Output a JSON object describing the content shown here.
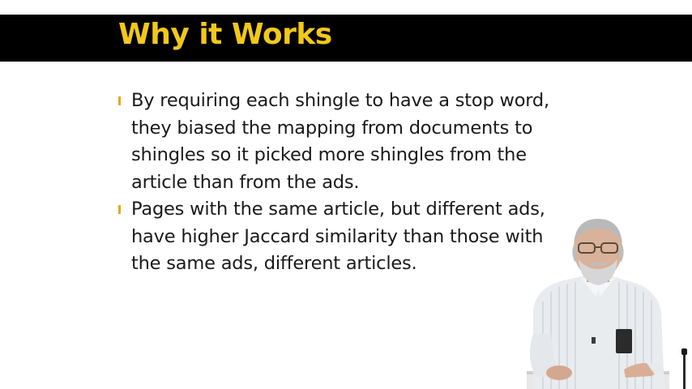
{
  "slide": {
    "title": "Why it Works",
    "bullets": [
      {
        "text": "By requiring each shingle to have a stop word, they biased the mapping from documents to shingles so it picked more shingles from the article than from the ads."
      },
      {
        "text": "Pages with the same article, but different ads, have higher Jaccard similarity than those with the same ads, different articles."
      }
    ]
  },
  "colors": {
    "title_bar": "#000000",
    "title_text": "#f2c81a",
    "bullet_marker": "#e6a817",
    "body_text": "#1a1a1a",
    "background": "#ffffff"
  },
  "presenter": {
    "icon": "presenter-video-overlay"
  }
}
